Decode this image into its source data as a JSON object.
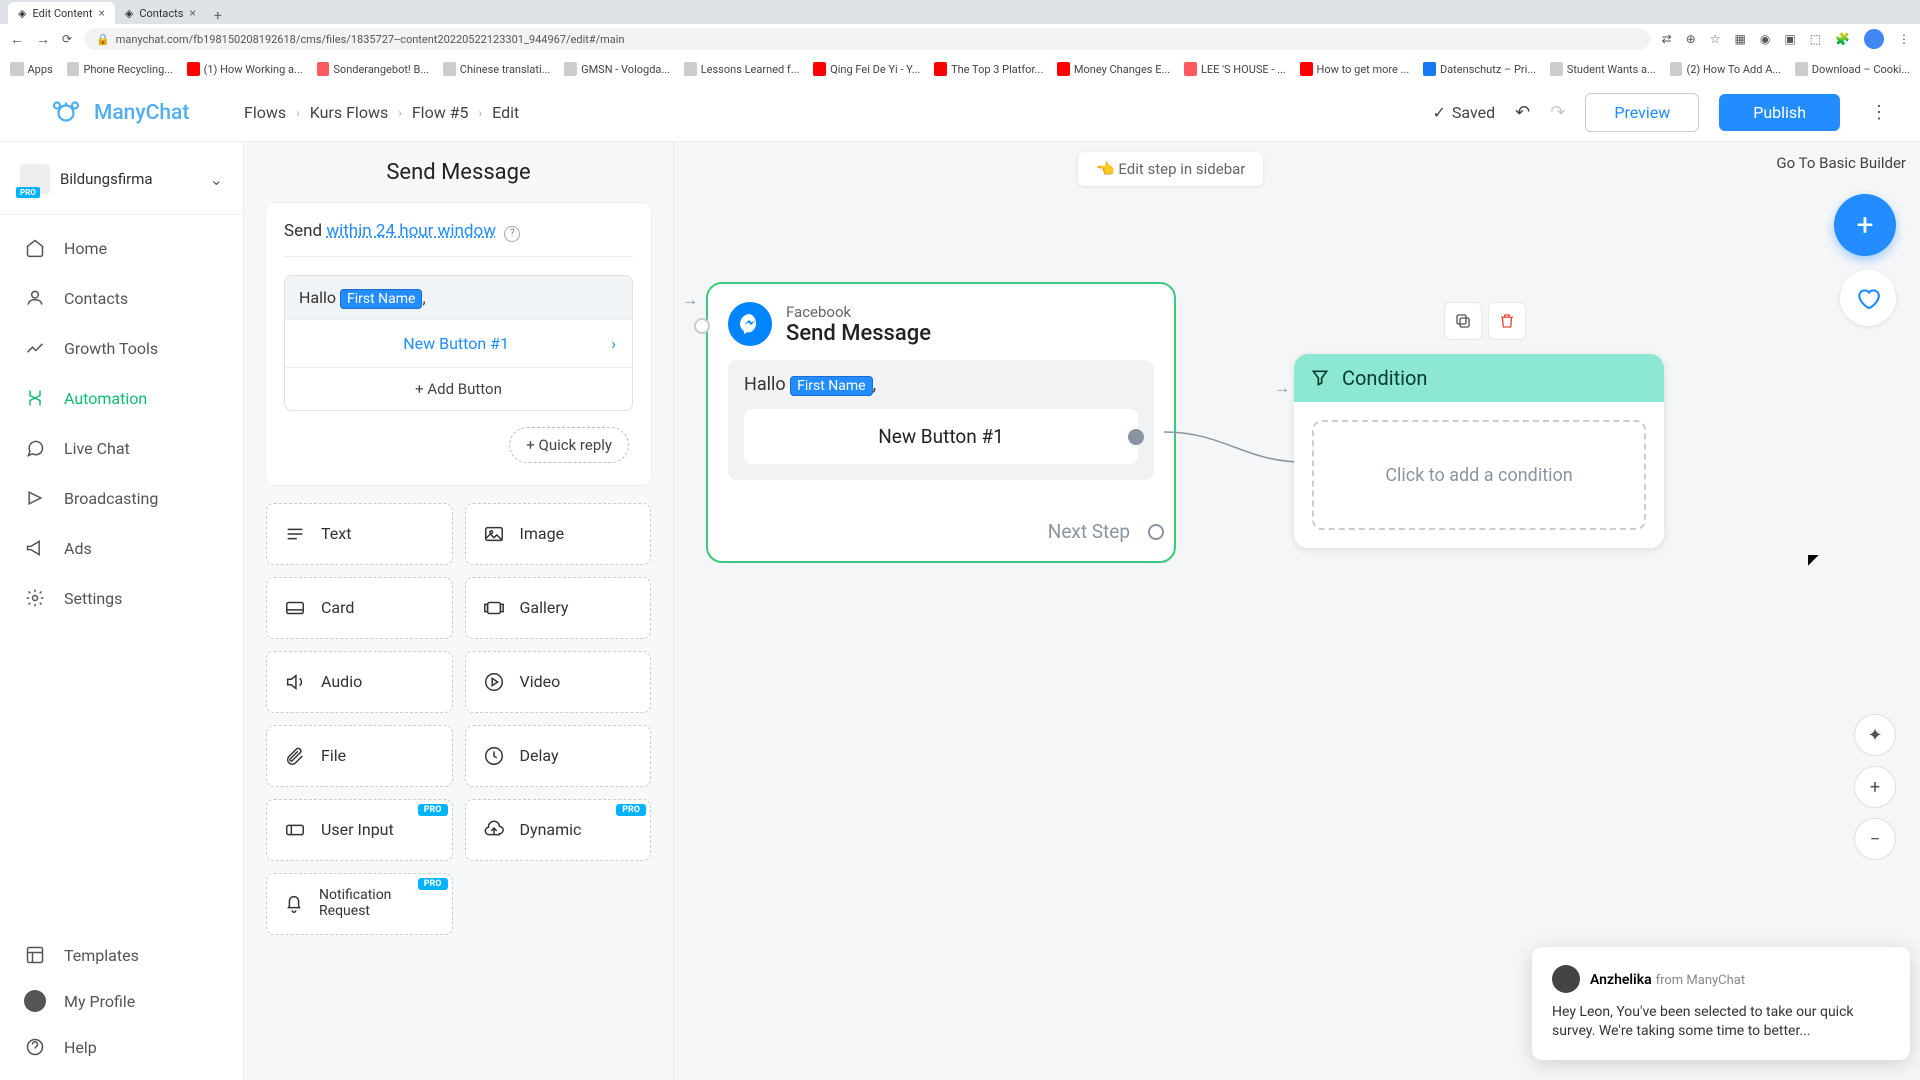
{
  "browser": {
    "tabs": [
      {
        "title": "Edit Content",
        "active": true
      },
      {
        "title": "Contacts",
        "active": false
      }
    ],
    "url": "manychat.com/fb198150208192618/cms/files/1835727--content20220522123301_944967/edit#/main",
    "bookmarks": [
      "Apps",
      "Phone Recycling...",
      "(1) How Working a...",
      "Sonderangebot! B...",
      "Chinese translati...",
      "GMSN - Vologda...",
      "Lessons Learned f...",
      "Qing Fei De Yi - Y...",
      "The Top 3 Platfor...",
      "Money Changes E...",
      "LEE 'S HOUSE - ...",
      "How to get more ...",
      "Datenschutz – Pri...",
      "Student Wants a...",
      "(2) How To Add A...",
      "Download – Cooki..."
    ]
  },
  "brand": "ManyChat",
  "breadcrumbs": [
    "Flows",
    "Kurs Flows",
    "Flow #5",
    "Edit"
  ],
  "header": {
    "saved": "Saved",
    "preview": "Preview",
    "publish": "Publish"
  },
  "account": {
    "name": "Bildungsfirma",
    "badge": "PRO"
  },
  "nav": [
    "Home",
    "Contacts",
    "Growth Tools",
    "Automation",
    "Live Chat",
    "Broadcasting",
    "Ads",
    "Settings"
  ],
  "nav_footer": [
    "Templates",
    "My Profile",
    "Help"
  ],
  "editor": {
    "title": "Send Message",
    "send_label": "Send",
    "send_link": "within 24 hour window",
    "greeting": "Hallo",
    "chip": "First Name",
    "button1": "New Button #1",
    "add_button": "+ Add Button",
    "quick_reply": "+ Quick reply",
    "blocks": [
      "Text",
      "Image",
      "Card",
      "Gallery",
      "Audio",
      "Video",
      "File",
      "Delay",
      "User Input",
      "Dynamic",
      "Notification Request"
    ],
    "pro": "PRO"
  },
  "canvas": {
    "edit_sidebar": "👈 Edit step in sidebar",
    "basic": "Go To Basic Builder",
    "node1": {
      "caption": "Facebook",
      "title": "Send Message",
      "greet": "Hallo",
      "chip": "First Name",
      "btn": "New Button #1",
      "next": "Next Step"
    },
    "condition": {
      "title": "Condition",
      "placeholder": "Click to add a condition"
    }
  },
  "chat": {
    "name": "Anzhelika",
    "from": "from ManyChat",
    "body": "Hey Leon,  You've been selected to take our quick survey. We're taking some time to better..."
  }
}
